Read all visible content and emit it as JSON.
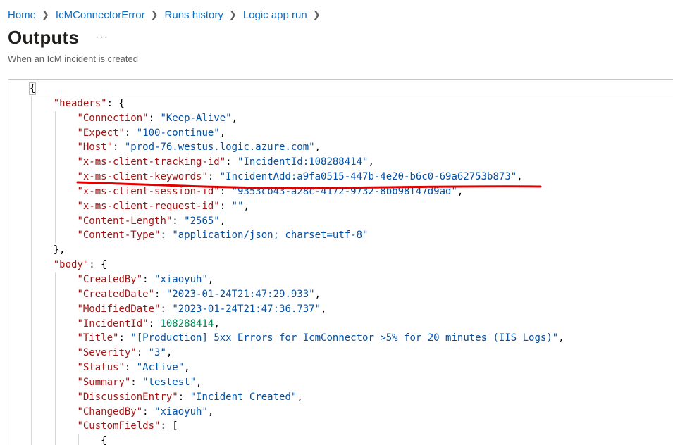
{
  "breadcrumb": [
    {
      "label": "Home"
    },
    {
      "label": "IcMConnectorError"
    },
    {
      "label": "Runs history"
    },
    {
      "label": "Logic app run"
    }
  ],
  "page": {
    "title": "Outputs",
    "more_label": "···",
    "subtitle": "When an IcM incident is created"
  },
  "json_lines": [
    {
      "indent": 0,
      "parts": [
        [
          "p",
          "{"
        ]
      ]
    },
    {
      "indent": 1,
      "parts": [
        [
          "k",
          "\"headers\""
        ],
        [
          "p",
          ": {"
        ]
      ]
    },
    {
      "indent": 2,
      "parts": [
        [
          "k",
          "\"Connection\""
        ],
        [
          "p",
          ": "
        ],
        [
          "s",
          "\"Keep-Alive\""
        ],
        [
          "p",
          ","
        ]
      ]
    },
    {
      "indent": 2,
      "parts": [
        [
          "k",
          "\"Expect\""
        ],
        [
          "p",
          ": "
        ],
        [
          "s",
          "\"100-continue\""
        ],
        [
          "p",
          ","
        ]
      ]
    },
    {
      "indent": 2,
      "parts": [
        [
          "k",
          "\"Host\""
        ],
        [
          "p",
          ": "
        ],
        [
          "s",
          "\"prod-76.westus.logic.azure.com\""
        ],
        [
          "p",
          ","
        ]
      ]
    },
    {
      "indent": 2,
      "parts": [
        [
          "k",
          "\"x-ms-client-tracking-id\""
        ],
        [
          "p",
          ": "
        ],
        [
          "s",
          "\"IncidentId:108288414\""
        ],
        [
          "p",
          ","
        ]
      ]
    },
    {
      "indent": 2,
      "parts": [
        [
          "k",
          "\"x-ms-client-keywords\""
        ],
        [
          "p",
          ": "
        ],
        [
          "s",
          "\"IncidentAdd:a9fa0515-447b-4e20-b6c0-69a62753b873\""
        ],
        [
          "p",
          ","
        ]
      ]
    },
    {
      "indent": 2,
      "parts": [
        [
          "k",
          "\"x-ms-client-session-id\""
        ],
        [
          "p",
          ": "
        ],
        [
          "s",
          "\"9353cb43-a28c-4172-9732-8bb98f47d9ad\""
        ],
        [
          "p",
          ","
        ]
      ]
    },
    {
      "indent": 2,
      "parts": [
        [
          "k",
          "\"x-ms-client-request-id\""
        ],
        [
          "p",
          ": "
        ],
        [
          "s",
          "\"\""
        ],
        [
          "p",
          ","
        ]
      ]
    },
    {
      "indent": 2,
      "parts": [
        [
          "k",
          "\"Content-Length\""
        ],
        [
          "p",
          ": "
        ],
        [
          "s",
          "\"2565\""
        ],
        [
          "p",
          ","
        ]
      ]
    },
    {
      "indent": 2,
      "parts": [
        [
          "k",
          "\"Content-Type\""
        ],
        [
          "p",
          ": "
        ],
        [
          "s",
          "\"application/json; charset=utf-8\""
        ]
      ]
    },
    {
      "indent": 1,
      "parts": [
        [
          "p",
          "},"
        ]
      ]
    },
    {
      "indent": 1,
      "parts": [
        [
          "k",
          "\"body\""
        ],
        [
          "p",
          ": {"
        ]
      ]
    },
    {
      "indent": 2,
      "parts": [
        [
          "k",
          "\"CreatedBy\""
        ],
        [
          "p",
          ": "
        ],
        [
          "s",
          "\"xiaoyuh\""
        ],
        [
          "p",
          ","
        ]
      ]
    },
    {
      "indent": 2,
      "parts": [
        [
          "k",
          "\"CreatedDate\""
        ],
        [
          "p",
          ": "
        ],
        [
          "s",
          "\"2023-01-24T21:47:29.933\""
        ],
        [
          "p",
          ","
        ]
      ]
    },
    {
      "indent": 2,
      "parts": [
        [
          "k",
          "\"ModifiedDate\""
        ],
        [
          "p",
          ": "
        ],
        [
          "s",
          "\"2023-01-24T21:47:36.737\""
        ],
        [
          "p",
          ","
        ]
      ]
    },
    {
      "indent": 2,
      "parts": [
        [
          "k",
          "\"IncidentId\""
        ],
        [
          "p",
          ": "
        ],
        [
          "n",
          "108288414"
        ],
        [
          "p",
          ","
        ]
      ]
    },
    {
      "indent": 2,
      "parts": [
        [
          "k",
          "\"Title\""
        ],
        [
          "p",
          ": "
        ],
        [
          "s",
          "\"[Production] 5xx Errors for IcmConnector >5% for 20 minutes (IIS Logs)\""
        ],
        [
          "p",
          ","
        ]
      ]
    },
    {
      "indent": 2,
      "parts": [
        [
          "k",
          "\"Severity\""
        ],
        [
          "p",
          ": "
        ],
        [
          "s",
          "\"3\""
        ],
        [
          "p",
          ","
        ]
      ]
    },
    {
      "indent": 2,
      "parts": [
        [
          "k",
          "\"Status\""
        ],
        [
          "p",
          ": "
        ],
        [
          "s",
          "\"Active\""
        ],
        [
          "p",
          ","
        ]
      ]
    },
    {
      "indent": 2,
      "parts": [
        [
          "k",
          "\"Summary\""
        ],
        [
          "p",
          ": "
        ],
        [
          "s",
          "\"testest\""
        ],
        [
          "p",
          ","
        ]
      ]
    },
    {
      "indent": 2,
      "parts": [
        [
          "k",
          "\"DiscussionEntry\""
        ],
        [
          "p",
          ": "
        ],
        [
          "s",
          "\"Incident Created\""
        ],
        [
          "p",
          ","
        ]
      ]
    },
    {
      "indent": 2,
      "parts": [
        [
          "k",
          "\"ChangedBy\""
        ],
        [
          "p",
          ": "
        ],
        [
          "s",
          "\"xiaoyuh\""
        ],
        [
          "p",
          ","
        ]
      ]
    },
    {
      "indent": 2,
      "parts": [
        [
          "k",
          "\"CustomFields\""
        ],
        [
          "p",
          ": ["
        ]
      ]
    },
    {
      "indent": 3,
      "parts": [
        [
          "p",
          "{"
        ]
      ]
    }
  ],
  "colors": {
    "link": "#0f6cbd",
    "json_key": "#a31515",
    "json_string": "#0451a5",
    "json_number": "#098658",
    "annotation_underline": "#e00000"
  }
}
